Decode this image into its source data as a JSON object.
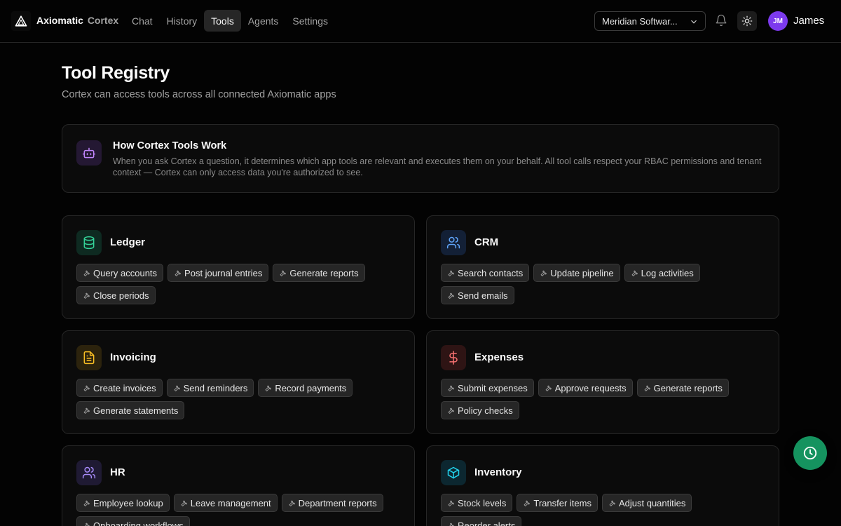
{
  "brand": {
    "name": "Axiomatic",
    "product": "Cortex"
  },
  "nav": [
    {
      "label": "Chat",
      "active": false
    },
    {
      "label": "History",
      "active": false
    },
    {
      "label": "Tools",
      "active": true
    },
    {
      "label": "Agents",
      "active": false
    },
    {
      "label": "Settings",
      "active": false
    }
  ],
  "tenant": {
    "selected": "Meridian Softwar..."
  },
  "user": {
    "initials": "JM",
    "name": "James",
    "avatar_color": "#7c3aed"
  },
  "page": {
    "title": "Tool Registry",
    "subtitle": "Cortex can access tools across all connected Axiomatic apps"
  },
  "info": {
    "title": "How Cortex Tools Work",
    "text": "When you ask Cortex a question, it determines which app tools are relevant and executes them on your behalf. All tool calls respect your RBAC permissions and tenant context — Cortex can only access data you're authorized to see.",
    "icon": "bot-icon"
  },
  "apps": [
    {
      "name": "Ledger",
      "icon": "database-icon",
      "color": "#34d399",
      "tools": [
        "Query accounts",
        "Post journal entries",
        "Generate reports",
        "Close periods"
      ]
    },
    {
      "name": "CRM",
      "icon": "users-icon",
      "color": "#60a5fa",
      "tools": [
        "Search contacts",
        "Update pipeline",
        "Log activities",
        "Send emails"
      ]
    },
    {
      "name": "Invoicing",
      "icon": "file-text-icon",
      "color": "#fbbf24",
      "tools": [
        "Create invoices",
        "Send reminders",
        "Record payments",
        "Generate statements"
      ]
    },
    {
      "name": "Expenses",
      "icon": "dollar-icon",
      "color": "#f87171",
      "tools": [
        "Submit expenses",
        "Approve requests",
        "Generate reports",
        "Policy checks"
      ]
    },
    {
      "name": "HR",
      "icon": "users-icon",
      "color": "#a78bfa",
      "tools": [
        "Employee lookup",
        "Leave management",
        "Department reports",
        "Onboarding workflows"
      ]
    },
    {
      "name": "Inventory",
      "icon": "box-icon",
      "color": "#22d3ee",
      "tools": [
        "Stock levels",
        "Transfer items",
        "Adjust quantities",
        "Reorder alerts"
      ]
    }
  ],
  "fab": {
    "icon": "clock-icon",
    "color": "#15935f"
  }
}
